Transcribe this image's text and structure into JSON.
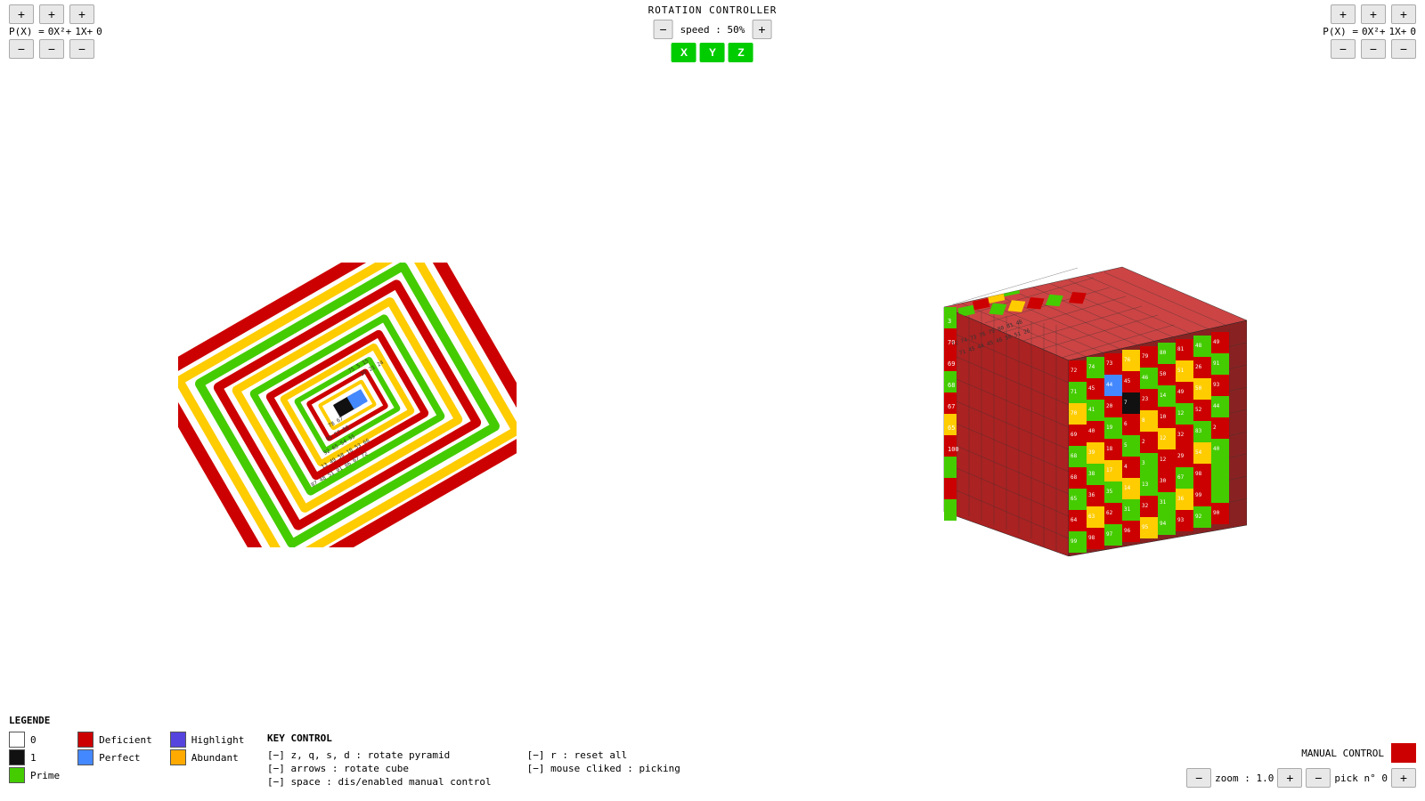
{
  "left_poly": {
    "label": "P(X) =",
    "terms": [
      "0X²+",
      "1X+",
      "0"
    ],
    "plus_label": "+",
    "minus_label": "−"
  },
  "right_poly": {
    "label": "P(X) =",
    "terms": [
      "0X²+",
      "1X+",
      "0"
    ],
    "plus_label": "+",
    "minus_label": "−"
  },
  "rotation_controller": {
    "title": "ROTATION CONTROLLER",
    "speed_label": "speed : 50%",
    "minus_label": "−",
    "plus_label": "+",
    "axes": [
      "X",
      "Y",
      "Z"
    ]
  },
  "legend": {
    "title": "LEGENDE",
    "items": [
      {
        "label": "0",
        "color": "#ffffff",
        "border": true
      },
      {
        "label": "Deficient",
        "color": "#cc0000"
      },
      {
        "label": "Highlight",
        "color": "#5555ff"
      },
      {
        "label": "1",
        "color": "#111111"
      },
      {
        "label": "Perfect",
        "color": "#4488ff"
      },
      {
        "label": "Abundant",
        "color": "#ffaa00"
      },
      {
        "label": "Prime",
        "color": "#44cc00"
      }
    ]
  },
  "key_control": {
    "title": "KEY CONTROL",
    "items": [
      {
        "key": "[−] z, q, s, d : rotate pyramid",
        "desc": "[−] r : reset all"
      },
      {
        "key": "[−] arrows : rotate cube",
        "desc": "[−] mouse cliked : picking"
      },
      {
        "key": "[−] space : dis/enabled manual control",
        "desc": ""
      }
    ]
  },
  "manual_control": {
    "title": "MANUAL CONTROL",
    "zoom_label": "zoom : 1.0",
    "pick_label": "pick n° 0",
    "minus_label": "−",
    "plus_label": "+"
  }
}
